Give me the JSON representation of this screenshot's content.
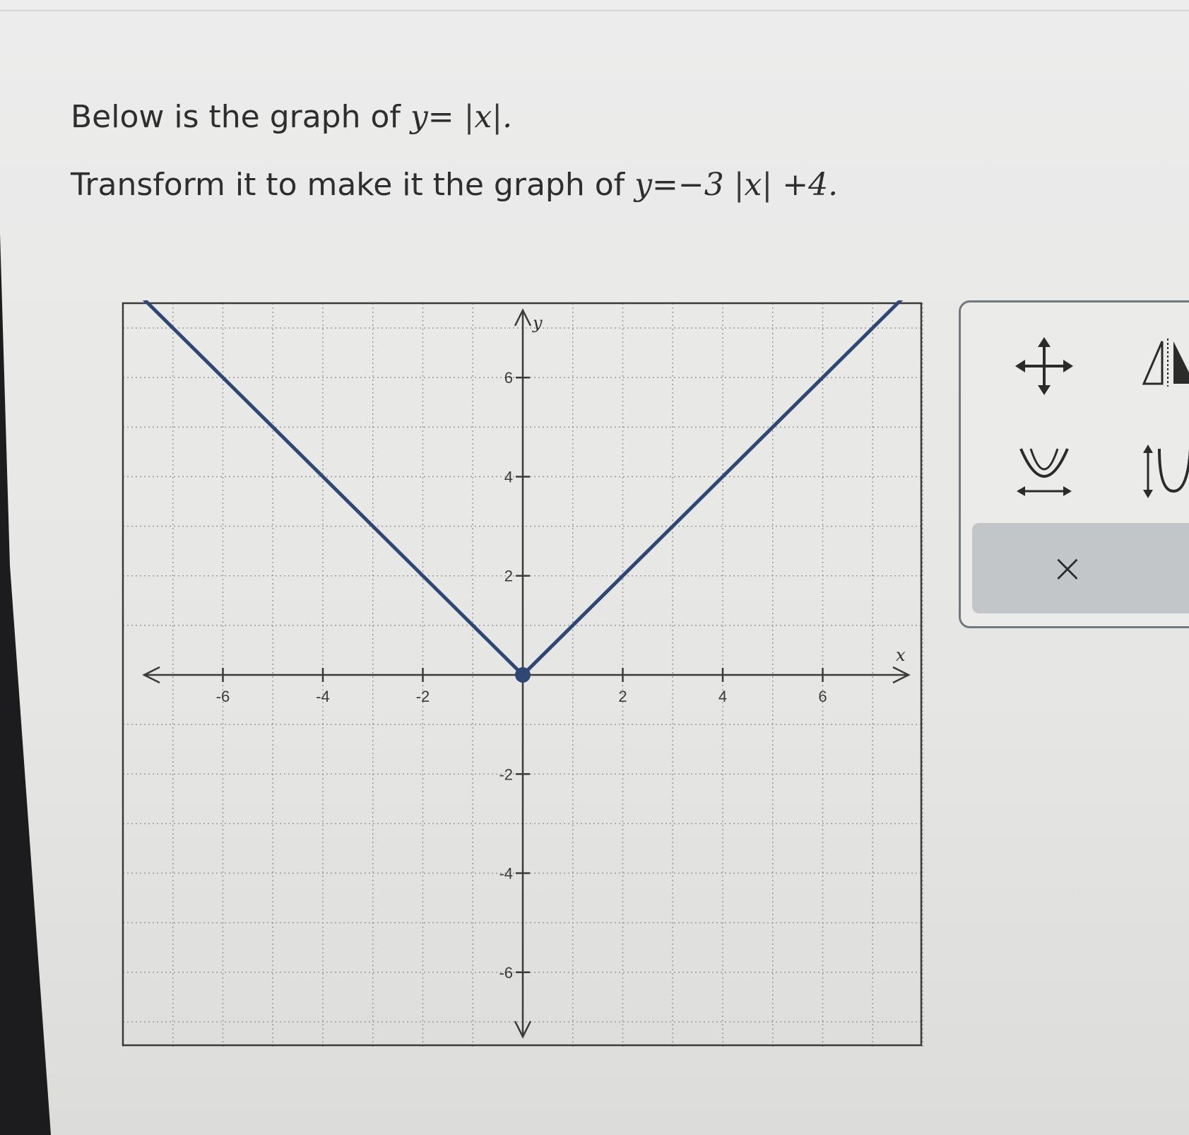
{
  "prompt": {
    "line1_text": "Below is the graph of",
    "line1_math": "y=",
    "line1_var": "x",
    "line2_text": "Transform it to make it the graph of",
    "line2_math_pre": "y=−3",
    "line2_var": "x",
    "line2_math_post": "+4."
  },
  "tools": {
    "move": "move-icon",
    "reflect": "reflect-icon",
    "horizontal_stretch": "horizontal-stretch-icon",
    "vertical_stretch": "vertical-stretch-icon",
    "clear_symbol": "×"
  },
  "chart_data": {
    "type": "line",
    "xlabel": "x",
    "ylabel": "y",
    "xlim": [
      -8,
      8
    ],
    "ylim": [
      -7.5,
      7.5
    ],
    "grid": true,
    "x_ticks": [
      -6,
      -4,
      -2,
      2,
      4,
      6
    ],
    "y_ticks": [
      -6,
      -4,
      -2,
      2,
      4,
      6
    ],
    "tick_labels_x": [
      "-6",
      "-4",
      "-2",
      "2",
      "4",
      "6"
    ],
    "tick_labels_y": [
      "-6",
      "-4",
      "-2",
      "2",
      "4",
      "6"
    ],
    "series": [
      {
        "x": [
          -8,
          0,
          8
        ],
        "y": [
          8,
          0,
          8
        ],
        "color": "#2f4775"
      }
    ],
    "vertex": {
      "x": 0,
      "y": 0
    }
  }
}
